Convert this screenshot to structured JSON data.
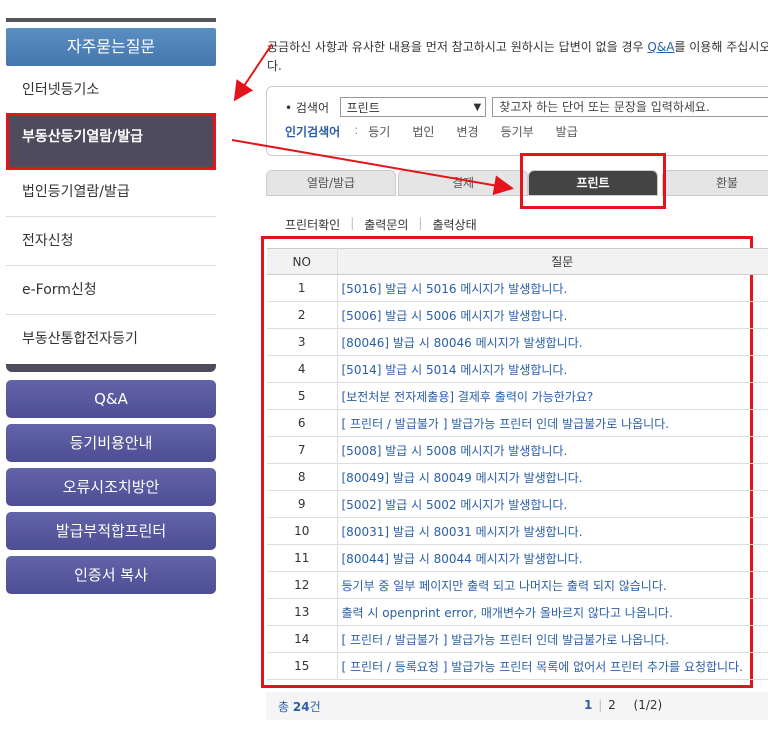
{
  "sidebar": {
    "title": "자주묻는질문",
    "items": [
      {
        "label": "인터넷등기소"
      },
      {
        "label": "부동산등기열람/발급"
      },
      {
        "label": "법인등기열람/발급"
      },
      {
        "label": "전자신청"
      },
      {
        "label": "e-Form신청"
      },
      {
        "label": "부동산통합전자등기"
      }
    ],
    "buttons": [
      {
        "label": "Q&A"
      },
      {
        "label": "등기비용안내"
      },
      {
        "label": "오류시조치방안"
      },
      {
        "label": "발급부적합프린터"
      },
      {
        "label": "인증서 복사"
      }
    ]
  },
  "intro": {
    "text_before": "궁금하신 사항과 유사한 내용을 먼저 참고하시고 원하시는 답변이 없을 경우 ",
    "link": "Q&A",
    "text_after": "를 이용해 주십시오다."
  },
  "search": {
    "label": "• 검색어",
    "selected": "프린트",
    "placeholder": "찾고자 하는 단어 또는 문장을 입력하세요.",
    "popular_label": "인기검색어",
    "popular_sep": ":",
    "popular": [
      "등기",
      "법인",
      "변경",
      "등기부",
      "발급"
    ]
  },
  "tabs": [
    "열람/발급",
    "결제",
    "프린트",
    "환불"
  ],
  "subtabs": [
    "프린터확인",
    "출력문의",
    "출력상태"
  ],
  "table": {
    "headers": [
      "NO",
      "질문"
    ],
    "rows": [
      {
        "no": "1",
        "q": "[5016] 발급 시 5016 메시지가 발생합니다."
      },
      {
        "no": "2",
        "q": "[5006] 발급 시 5006 메시지가 발생합니다."
      },
      {
        "no": "3",
        "q": "[80046] 발급 시 80046 메시지가 발생합니다."
      },
      {
        "no": "4",
        "q": "[5014] 발급 시 5014 메시지가 발생합니다."
      },
      {
        "no": "5",
        "q": "[보전처분 전자제출용] 결제후 출력이 가능한가요?"
      },
      {
        "no": "6",
        "q": "[ 프린터 / 발급불가 ] 발급가능 프린터 인데 발급불가로 나옵니다."
      },
      {
        "no": "7",
        "q": "[5008] 발급 시 5008 메시지가 발생합니다."
      },
      {
        "no": "8",
        "q": "[80049] 발급 시 80049 메시지가 발생합니다."
      },
      {
        "no": "9",
        "q": "[5002] 발급 시 5002 메시지가 발생합니다."
      },
      {
        "no": "10",
        "q": "[80031] 발급 시 80031 메시지가 발생합니다."
      },
      {
        "no": "11",
        "q": "[80044] 발급 시 80044 메시지가 발생합니다."
      },
      {
        "no": "12",
        "q": "등기부 중 일부 페이지만 출력 되고 나머지는 출력 되지 않습니다."
      },
      {
        "no": "13",
        "q": "출력 시 openprint error, 매개변수가 올바르지 않다고 나옵니다."
      },
      {
        "no": "14",
        "q": "[ 프린터 / 발급불가 ] 발급가능 프린터 인데 발급불가로 나옵니다."
      },
      {
        "no": "15",
        "q": "[ 프린터 / 등록요청 ] 발급가능 프린터 목록에 없어서 프린터 추가를 요청합니다."
      }
    ]
  },
  "footer": {
    "total_prefix": "총",
    "total_count": "24",
    "total_suffix": "건",
    "pages": [
      "1",
      "2"
    ],
    "page_sep": "|",
    "page_status": "(1/2)"
  },
  "colors": {
    "highlight": "#e4141b",
    "accent": "#2a5fa8",
    "nav": "#4d4e95"
  }
}
